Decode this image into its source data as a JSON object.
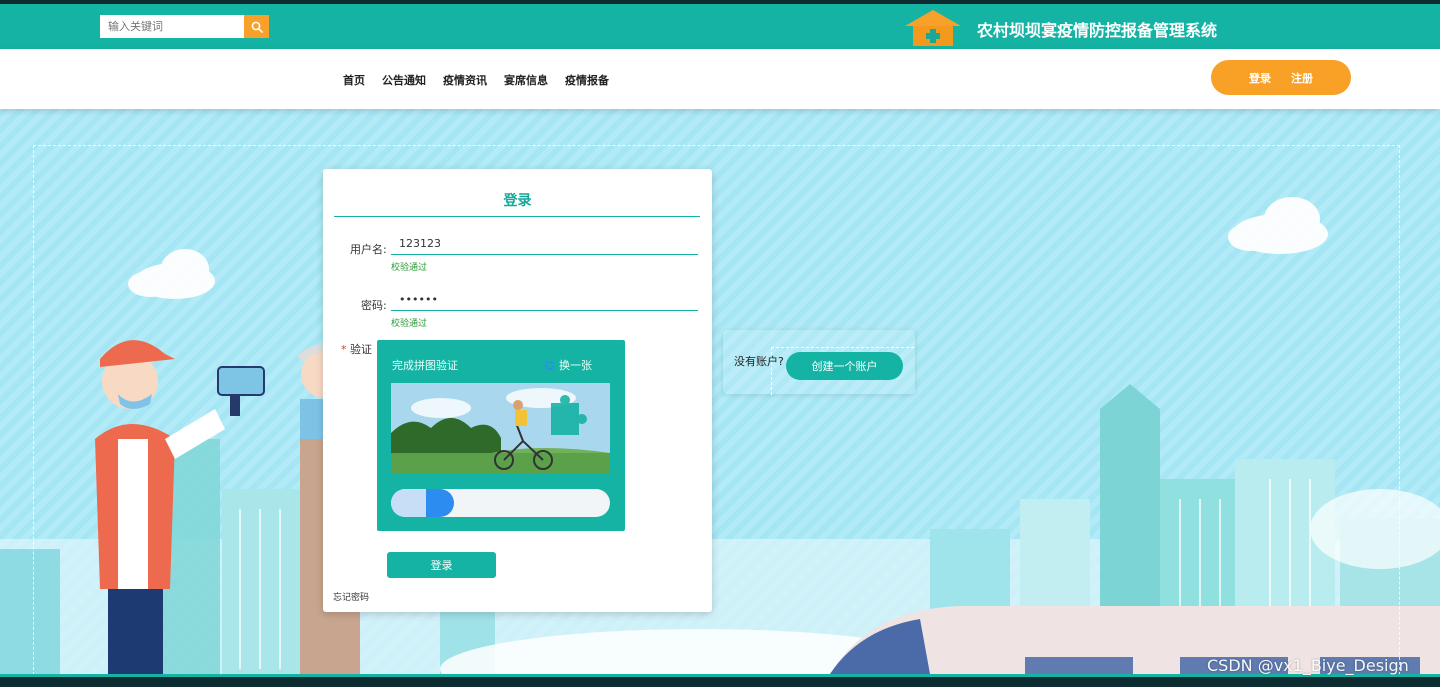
{
  "header": {
    "search_placeholder": "输入关键词",
    "system_title": "农村坝坝宴疫情防控报备管理系统"
  },
  "nav": {
    "items": [
      "首页",
      "公告通知",
      "疫情资讯",
      "宴席信息",
      "疫情报备"
    ],
    "login": "登录",
    "register": "注册"
  },
  "login_form": {
    "title": "登录",
    "username_label": "用户名:",
    "username_value": "123123",
    "username_hint": "校验通过",
    "password_label": "密码:",
    "password_value": "123456",
    "password_hint": "校验通过",
    "verify_required": "*",
    "verify_label": "验证",
    "captcha_title": "完成拼图验证",
    "captcha_refresh": "换一张",
    "submit": "登录",
    "forgot": "忘记密码"
  },
  "register_box": {
    "no_account": "没有账户?",
    "create": "创建一个账户"
  },
  "watermark": "CSDN @vx1_Biye_Design",
  "colors": {
    "primary": "#15b3a4",
    "accent": "#f9a126",
    "slider_handle": "#2d8cf0",
    "hint": "#2e9a3a"
  }
}
